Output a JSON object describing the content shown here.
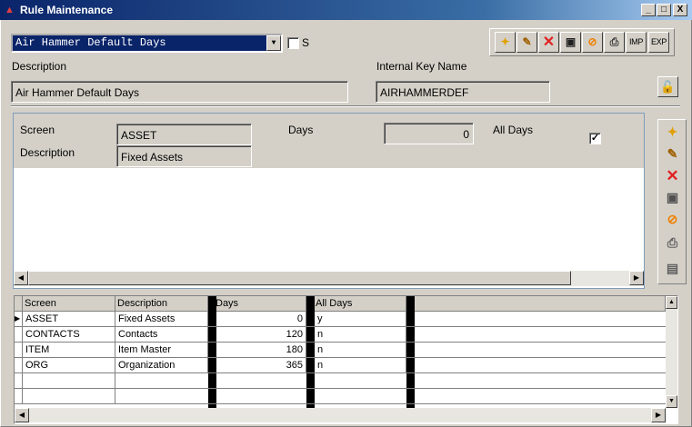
{
  "window": {
    "title": "Rule Maintenance",
    "min": "_",
    "max": "□",
    "close": "X"
  },
  "rule_select": {
    "value": "Air Hammer Default Days",
    "s_label": "S"
  },
  "toolbar": {
    "imp": "IMP",
    "exp": "EXP"
  },
  "form": {
    "description_label": "Description",
    "description_value": "Air Hammer Default Days",
    "key_label": "Internal Key Name",
    "key_value": "AIRHAMMERDEF"
  },
  "detail": {
    "screen_label": "Screen",
    "screen_value": "ASSET",
    "description_label": "Description",
    "description_value": "Fixed Assets",
    "days_label": "Days",
    "days_value": "0",
    "alldays_label": "All Days",
    "alldays_checked": "✓"
  },
  "grid": {
    "columns": [
      "Screen",
      "Description",
      "Days",
      "All Days"
    ],
    "rows": [
      {
        "screen": "ASSET",
        "description": "Fixed Assets",
        "days": "0",
        "alldays": "y"
      },
      {
        "screen": "CONTACTS",
        "description": "Contacts",
        "days": "120",
        "alldays": "n"
      },
      {
        "screen": "ITEM",
        "description": "Item Master",
        "days": "180",
        "alldays": "n"
      },
      {
        "screen": "ORG",
        "description": "Organization",
        "days": "365",
        "alldays": "n"
      }
    ]
  }
}
